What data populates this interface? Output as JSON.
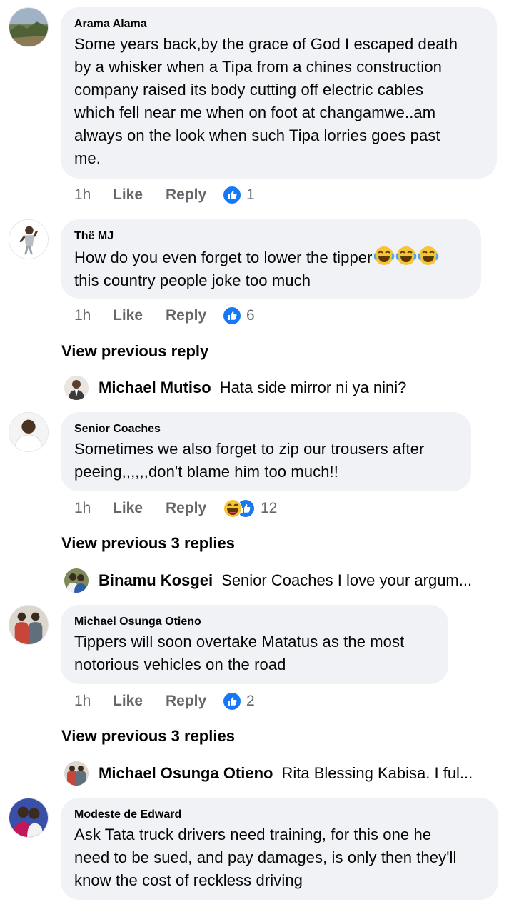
{
  "comments": [
    {
      "author": "Arama Alama",
      "text": "Some years back,by the grace of God I escaped death by a whisker when a Tipa from a chines construction company  raised its body cutting off electric cables which fell near me when on foot at changamwe..am always on the look when such Tipa lorries goes past me.",
      "lines": [
        "Some years back,by the grace of God I escaped death",
        "by a whisker when a Tipa from a chines construction",
        "company  raised its body cutting off electric cables",
        "which fell near me when on foot at changamwe..am",
        "always on the look when such Tipa lorries goes past",
        "me."
      ],
      "time": "1h",
      "like": "Like",
      "reply": "Reply",
      "reaction_icon": "like-reaction-icon",
      "reactions": "1"
    },
    {
      "author": "Thë MJ",
      "lines": [
        "How do you even forget to lower the tipper",
        "this country people joke too much"
      ],
      "emoji_icons": [
        "laughing-emoji-icon",
        "laughing-emoji-icon",
        "laughing-emoji-icon"
      ],
      "time": "1h",
      "like": "Like",
      "reply": "Reply",
      "reaction_icon": "like-reaction-icon",
      "reactions": "6",
      "view_previous": "View previous reply",
      "latest_reply": {
        "author": "Michael Mutiso",
        "text": "Hata side mirror ni ya nini?"
      }
    },
    {
      "author": "Senior Coaches",
      "lines": [
        "Sometimes we also forget to zip our trousers after",
        "peeing,,,,,,don't blame him too much!!"
      ],
      "time": "1h",
      "like": "Like",
      "reply": "Reply",
      "reaction_icon": "haha-like-reaction-icon",
      "reactions": "12",
      "view_previous": "View previous 3 replies",
      "latest_reply": {
        "author": "Binamu Kosgei",
        "text": "Senior Coaches I love your argum..."
      }
    },
    {
      "author": "Michael Osunga Otieno",
      "lines": [
        "Tippers will soon overtake Matatus as the most",
        "notorious vehicles on the road"
      ],
      "time": "1h",
      "like": "Like",
      "reply": "Reply",
      "reaction_icon": "like-reaction-icon",
      "reactions": "2",
      "view_previous": "View previous 3 replies",
      "latest_reply": {
        "author": "Michael Osunga Otieno",
        "text": "Rita Blessing Kabisa. I ful..."
      }
    },
    {
      "author": "Modeste de Edward",
      "lines": [
        "Ask Tata truck drivers need training,  for this one he",
        "need to be sued,  and pay damages, is only then they'll",
        "know the cost of reckless driving"
      ]
    }
  ],
  "colors": {
    "bubble": "#f0f2f5",
    "meta": "#65676b",
    "like_blue": "#1877f2",
    "text": "#050505"
  }
}
